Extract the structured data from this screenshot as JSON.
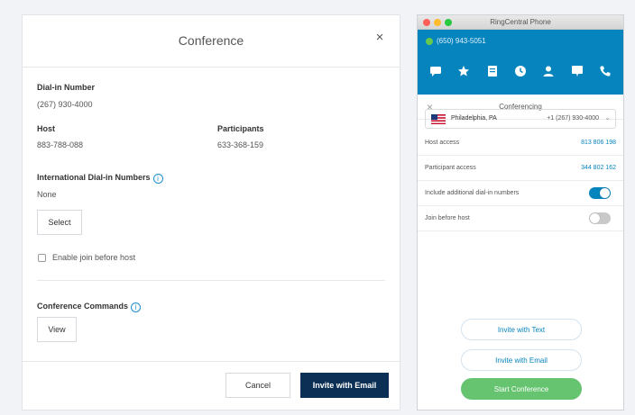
{
  "dialog": {
    "title": "Conference",
    "close_glyph": "×",
    "dial_in_label": "Dial-in Number",
    "dial_in_number": "(267) 930-4000",
    "host_label": "Host",
    "host_code": "883-788-088",
    "participants_label": "Participants",
    "participants_code": "633-368-159",
    "intl_label": "International Dial-in Numbers",
    "intl_value": "None",
    "select_label": "Select",
    "join_before_host_label": "Enable join before host",
    "join_before_host_checked": false,
    "commands_label": "Conference Commands",
    "view_label": "View",
    "cancel_label": "Cancel",
    "invite_email_label": "Invite with Email"
  },
  "phone": {
    "window_title": "RingCentral Phone",
    "phone_number": "(650) 943-5051",
    "status_color": "#65c84f",
    "brand_color": "#0684bd",
    "nav_icons": [
      "message-icon",
      "star-icon",
      "fax-icon",
      "history-icon",
      "contacts-icon",
      "chat-icon",
      "phone-icon"
    ],
    "conf_title": "Conferencing",
    "location": {
      "name": "Philadelphia, PA",
      "number": "+1 (267) 930-4000",
      "flag": "us-flag-icon"
    },
    "rows": [
      {
        "label": "Host access",
        "value": "813 806 198"
      },
      {
        "label": "Participant access",
        "value": "344 802 162"
      }
    ],
    "toggles": [
      {
        "label": "Include additional dial-in numbers",
        "on": true
      },
      {
        "label": "Join before host",
        "on": false
      }
    ],
    "invite_text_label": "Invite with Text",
    "invite_email_label": "Invite with Email",
    "start_label": "Start Conference",
    "start_color": "#66c36f"
  }
}
